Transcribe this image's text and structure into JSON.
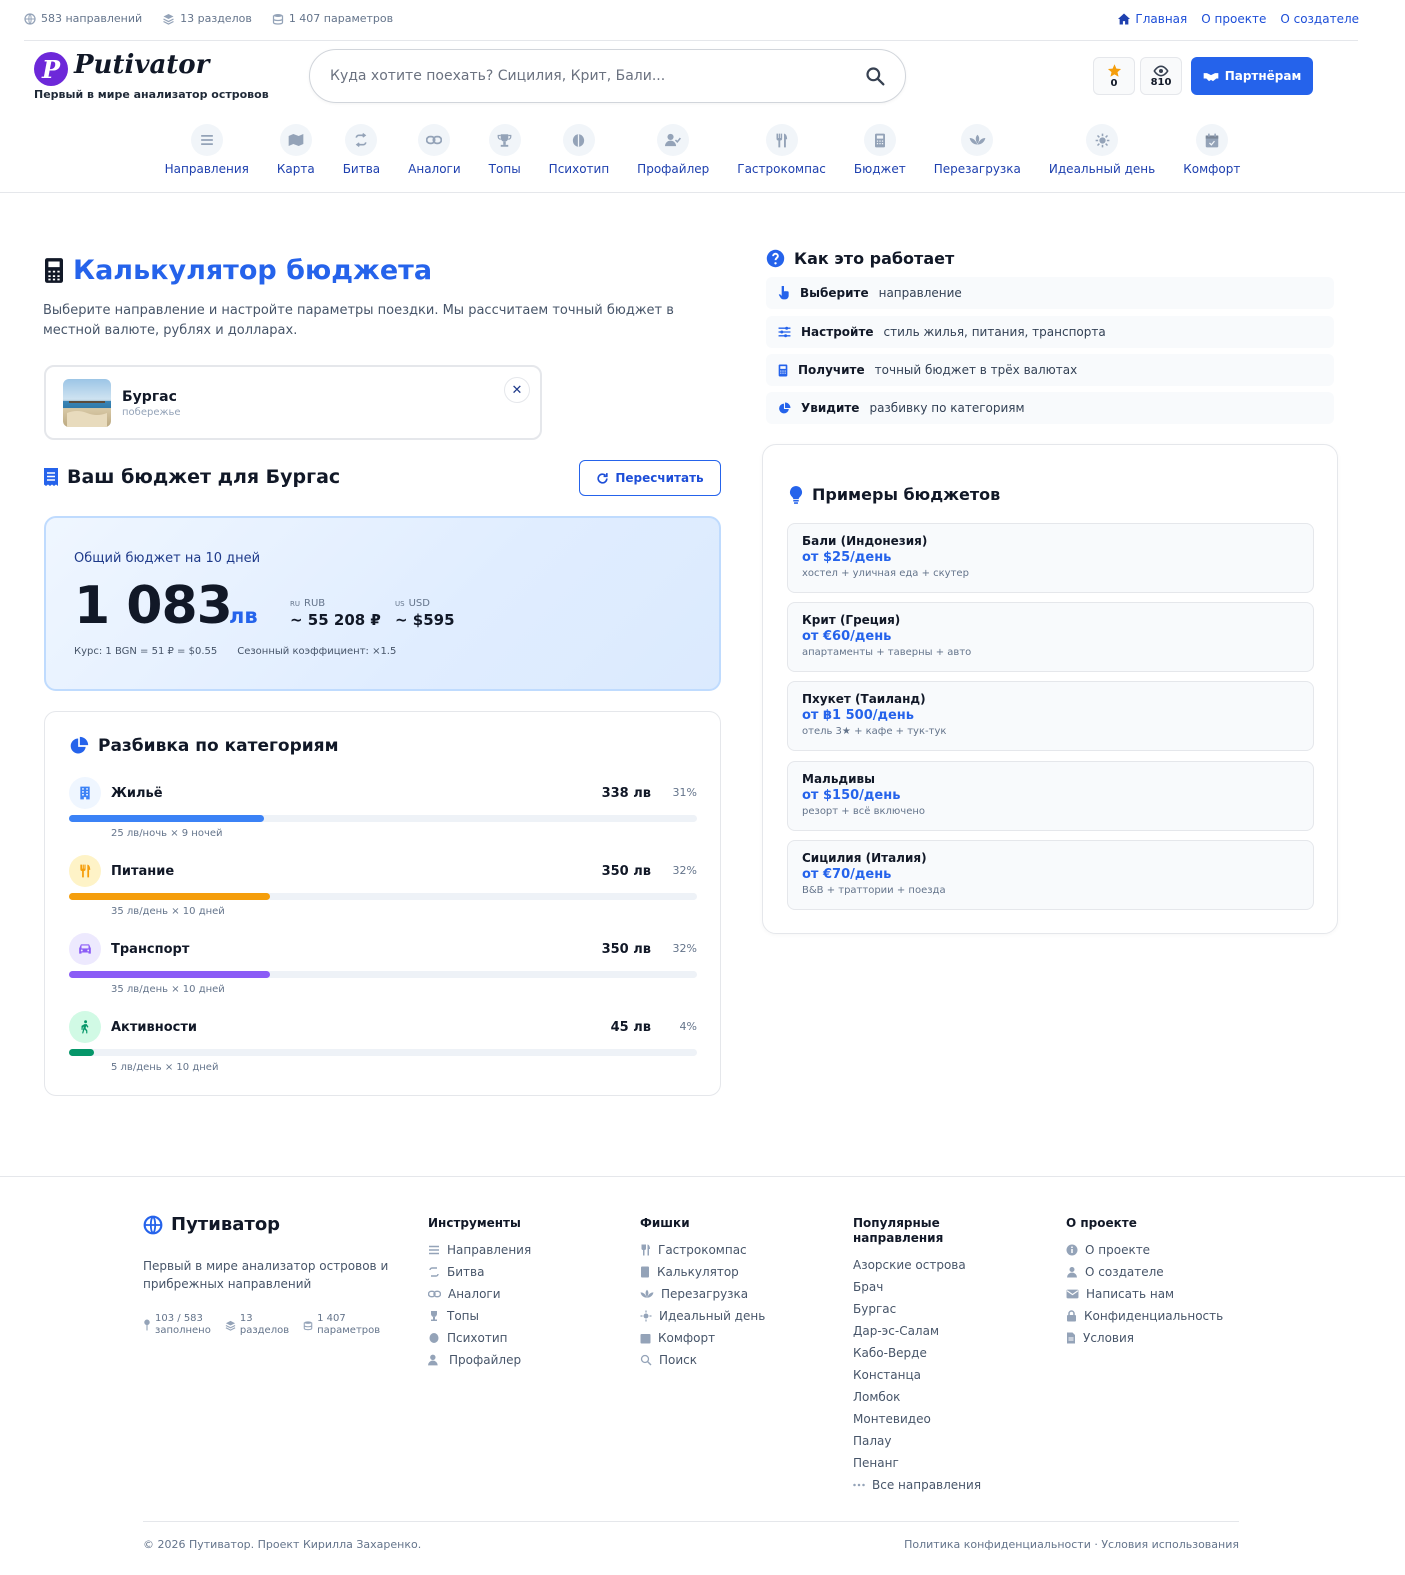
{
  "topbar": {
    "stats": [
      "583 направлений",
      "13 разделов",
      "1 407 параметров"
    ],
    "links": [
      "Главная",
      "О проекте",
      "О создателе"
    ]
  },
  "header": {
    "logo_letter": "P",
    "logo_word": "Putivator",
    "tagline": "Первый в мире анализатор островов",
    "search_placeholder": "Куда хотите поехать? Сицилия, Крит, Бали...",
    "favorites_count": "0",
    "views_count": "810",
    "partner_label": "Партнёрам"
  },
  "nav": [
    {
      "label": "Направления",
      "icon": "list-icon"
    },
    {
      "label": "Карта",
      "icon": "map-icon"
    },
    {
      "label": "Битва",
      "icon": "battle-icon"
    },
    {
      "label": "Аналоги",
      "icon": "link-icon"
    },
    {
      "label": "Топы",
      "icon": "trophy-icon"
    },
    {
      "label": "Психотип",
      "icon": "brain-icon"
    },
    {
      "label": "Профайлер",
      "icon": "user-check-icon"
    },
    {
      "label": "Гастрокомпас",
      "icon": "utensils-icon"
    },
    {
      "label": "Бюджет",
      "icon": "calculator-icon"
    },
    {
      "label": "Перезагрузка",
      "icon": "lotus-icon"
    },
    {
      "label": "Идеальный день",
      "icon": "sun-icon"
    },
    {
      "label": "Комфорт",
      "icon": "calendar-icon"
    }
  ],
  "main": {
    "title": "Калькулятор бюджета",
    "description": "Выберите направление и настройте параметры поездки. Мы рассчитаем точный бюджет в местной валюте, рублях и долларах.",
    "destination": {
      "name": "Бургас",
      "type": "побережье",
      "clear": "✕"
    },
    "budget_title": "Ваш бюджет для Бургас",
    "recalc_label": "Пересчитать",
    "total": {
      "label": "Общий бюджет на 10 дней",
      "amount": "1 083",
      "currency": "лв",
      "rub_code": "RU",
      "rub_label": "RUB",
      "rub_value": "~ 55 208 ₽",
      "usd_code": "US",
      "usd_label": "USD",
      "usd_value": "~ $595",
      "rate": "Курс: 1 BGN = 51 ₽ = $0.55",
      "season": "Сезонный коэффициент: ×1.5"
    },
    "categories_title": "Разбивка по категориям",
    "categories": [
      {
        "name": "Жильё",
        "amount": "338 лв",
        "percent": "31%",
        "share": 31,
        "note": "25 лв/ночь × 9 ночей",
        "color": "#3b82f6",
        "bg": "#eff6ff",
        "icon": "building-icon"
      },
      {
        "name": "Питание",
        "amount": "350 лв",
        "percent": "32%",
        "share": 32,
        "note": "35 лв/день × 10 дней",
        "color": "#f59e0b",
        "bg": "#fef3c7",
        "icon": "utensils-icon"
      },
      {
        "name": "Транспорт",
        "amount": "350 лв",
        "percent": "32%",
        "share": 32,
        "note": "35 лв/день × 10 дней",
        "color": "#8b5cf6",
        "bg": "#ede9fe",
        "icon": "car-icon"
      },
      {
        "name": "Активности",
        "amount": "45 лв",
        "percent": "4%",
        "share": 4,
        "note": "5 лв/день × 10 дней",
        "color": "#059669",
        "bg": "#d1fae5",
        "icon": "hiking-icon"
      }
    ]
  },
  "how": {
    "title": "Как это работает",
    "steps": [
      {
        "bold": "Выберите",
        "text": "направление",
        "icon": "pointer-icon"
      },
      {
        "bold": "Настройте",
        "text": "стиль жилья, питания, транспорта",
        "icon": "sliders-icon"
      },
      {
        "bold": "Получите",
        "text": "точный бюджет в трёх валютах",
        "icon": "calculator-icon"
      },
      {
        "bold": "Увидите",
        "text": "разбивку по категориям",
        "icon": "pie-icon"
      }
    ]
  },
  "examples": {
    "title": "Примеры бюджетов",
    "items": [
      {
        "name": "Бали (Индонезия)",
        "price": "от $25/день",
        "note": "хостел + уличная еда + скутер"
      },
      {
        "name": "Крит (Греция)",
        "price": "от €60/день",
        "note": "апартаменты + таверны + авто"
      },
      {
        "name": "Пхукет (Таиланд)",
        "price": "от ฿1 500/день",
        "note": "отель 3★ + кафе + тук-тук"
      },
      {
        "name": "Мальдивы",
        "price": "от $150/день",
        "note": "резорт + всё включено"
      },
      {
        "name": "Сицилия (Италия)",
        "price": "от €70/день",
        "note": "B&B + траттории + поезда"
      }
    ]
  },
  "footer": {
    "brand": "Путиватор",
    "description": "Первый в мире анализатор островов и прибрежных направлений",
    "stats": [
      {
        "top": "103 / 583",
        "bottom": "заполнено"
      },
      {
        "top": "13",
        "bottom": "разделов"
      },
      {
        "top": "1 407",
        "bottom": "параметров"
      }
    ],
    "tools_title": "Инструменты",
    "tools": [
      "Направления",
      "Битва",
      "Аналоги",
      "Топы",
      "Психотип",
      "Профайлер"
    ],
    "features_title": "Фишки",
    "features": [
      "Гастрокомпас",
      "Калькулятор",
      "Перезагрузка",
      "Идеальный день",
      "Комфорт",
      "Поиск"
    ],
    "popular_title": "Популярные направления",
    "popular": [
      "Азорские острова",
      "Брач",
      "Бургас",
      "Дар-эс-Салам",
      "Кабо-Верде",
      "Констанца",
      "Ломбок",
      "Монтевидео",
      "Палау",
      "Пенанг"
    ],
    "popular_all": "Все направления",
    "about_title": "О проекте",
    "about": [
      "О проекте",
      "О создателе",
      "Написать нам",
      "Конфиденциальность",
      "Условия"
    ],
    "copyright": "© 2026 Путиватор. Проект Кирилла Захаренко.",
    "legal": "Политика конфиденциальности · Условия использования"
  }
}
